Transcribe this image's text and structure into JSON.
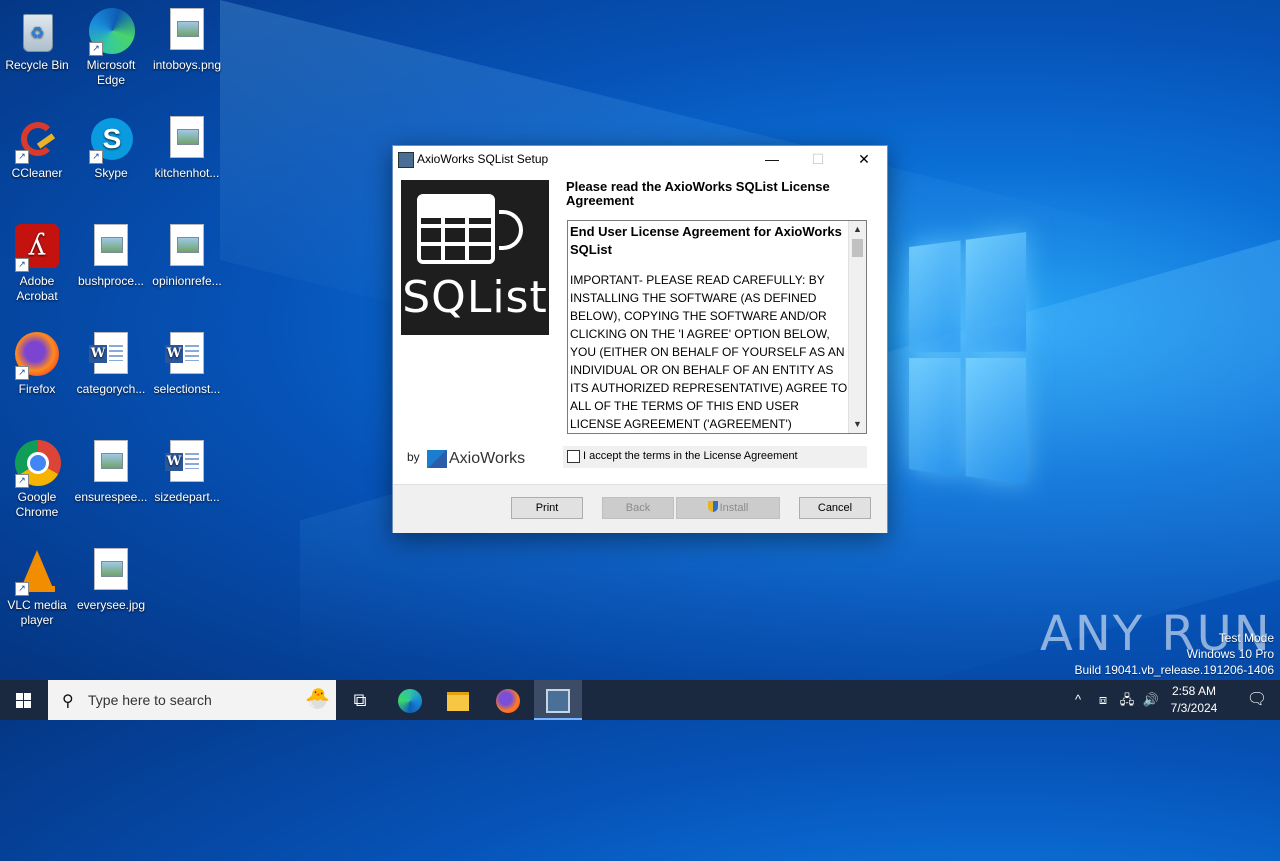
{
  "desktop": {
    "icons": [
      {
        "label": "Recycle Bin",
        "icon": "recycle-bin-icon"
      },
      {
        "label": "Microsoft Edge",
        "icon": "edge-icon"
      },
      {
        "label": "intoboys.png",
        "icon": "image-file-icon"
      },
      {
        "label": "CCleaner",
        "icon": "ccleaner-icon"
      },
      {
        "label": "Skype",
        "icon": "skype-icon"
      },
      {
        "label": "kitchenhot...",
        "icon": "image-file-icon"
      },
      {
        "label": "Adobe Acrobat",
        "icon": "acrobat-icon"
      },
      {
        "label": "bushproce...",
        "icon": "image-file-icon"
      },
      {
        "label": "opinionrefe...",
        "icon": "image-file-icon"
      },
      {
        "label": "Firefox",
        "icon": "firefox-icon"
      },
      {
        "label": "categorych...",
        "icon": "word-file-icon"
      },
      {
        "label": "selectionst...",
        "icon": "word-file-icon"
      },
      {
        "label": "Google Chrome",
        "icon": "chrome-icon"
      },
      {
        "label": "ensurespee...",
        "icon": "image-file-icon"
      },
      {
        "label": "sizedepart...",
        "icon": "word-file-icon"
      },
      {
        "label": "VLC media player",
        "icon": "vlc-icon"
      },
      {
        "label": "everysee.jpg",
        "icon": "image-file-icon"
      }
    ]
  },
  "dialog": {
    "title": "AxioWorks SQList Setup",
    "minimize": "—",
    "maximize": "☐",
    "close": "✕",
    "logo_text": "SQList",
    "by_label": "by",
    "brand": "AxioWorks",
    "heading": "Please read the AxioWorks SQList License Agreement",
    "license_title": "End User License Agreement for AxioWorks SQList",
    "license_body": "IMPORTANT- PLEASE READ CAREFULLY: BY INSTALLING THE SOFTWARE (AS DEFINED BELOW), COPYING THE SOFTWARE AND/OR CLICKING ON THE 'I AGREE' OPTION BELOW, YOU (EITHER ON BEHALF OF YOURSELF AS AN INDIVIDUAL OR ON BEHALF OF AN ENTITY AS ITS AUTHORIZED REPRESENTATIVE) AGREE TO ALL OF THE TERMS OF THIS END USER LICENSE AGREEMENT ('AGREEMENT') REGARDING YOUR",
    "accept_label": "I accept the terms in the License Agreement",
    "accept_checked": false,
    "buttons": {
      "print": "Print",
      "back": "Back",
      "install": "Install",
      "cancel": "Cancel"
    }
  },
  "watermark": {
    "brand": "ANY RUN",
    "line1": "Test Mode",
    "line2": "Windows 10 Pro",
    "line3": "Build 19041.vb_release.191206-1406"
  },
  "taskbar": {
    "search_placeholder": "Type here to search",
    "time": "2:58 AM",
    "date": "7/3/2024"
  },
  "colors": {
    "taskbar": "#1b2940",
    "accent": "#0078d7",
    "dialog_footer": "#f0f0f0"
  }
}
